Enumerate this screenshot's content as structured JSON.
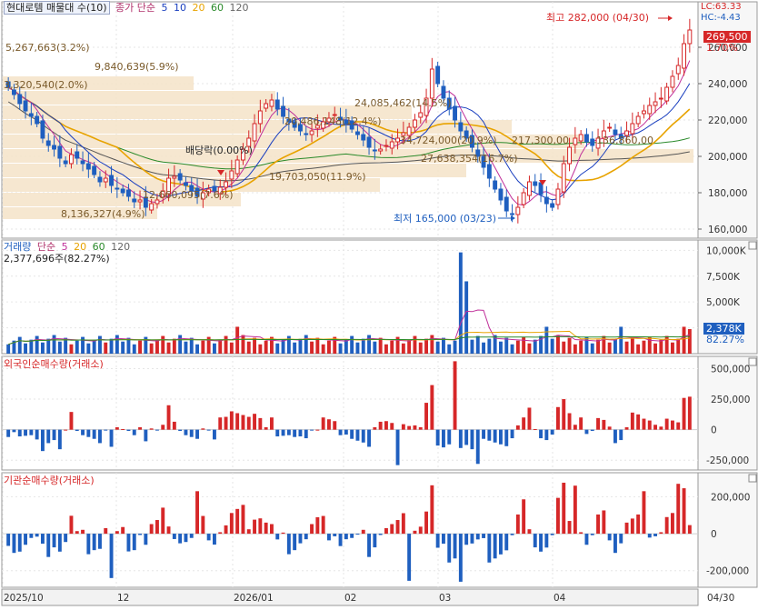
{
  "price_panel": {
    "legend": {
      "name": "현대로템 매물대 수(10)",
      "series_label": "종가 단순",
      "ma_periods": [
        "5",
        "10",
        "20",
        "60",
        "120"
      ],
      "ma_colors": [
        "#1a3fbf",
        "#1a3fbf",
        "#e8a300",
        "#2a8a2a",
        "#555555"
      ]
    },
    "right_labels": {
      "lc": "LC:63.33",
      "hc": "HC:-4.43"
    },
    "current_price": "269,500",
    "current_change": "1.70%",
    "high_annotation": "최고 282,000 (04/30)",
    "low_annotation": "최저 165,000 (03/23)",
    "dividend_label": "배당락(0.00%)",
    "volume_profile_labels": [
      "5,267,663(3.2%)",
      "9,840,639(5.9%)",
      "3,320,540(2.0%)",
      "24,085,462(14.5%)",
      "20,486,148(12.4%)",
      "34,724,000(20.9%)",
      "217,300,00",
      "136,860,00",
      "27,638,354(16.7%)",
      "19,703,050(11.9%)",
      "12,660,095(7.6%)",
      "8,136,327(4.9%)"
    ],
    "axis_ticks": [
      "260,000",
      "240,000",
      "220,000",
      "200,000",
      "180,000",
      "160,000"
    ],
    "up_color": "#d62728",
    "down_color": "#1f5fbf"
  },
  "volume_panel": {
    "title": "거래량",
    "legend_label": "단순",
    "ma_periods": [
      "5",
      "20",
      "60",
      "120"
    ],
    "info": "2,377,696주(82.27%)",
    "current_value": "2,378K",
    "current_pct": "82.27%",
    "axis_ticks": [
      "10,000K",
      "7,500K",
      "5,000K",
      "2,500K"
    ]
  },
  "foreign_panel": {
    "title": "외국인순매수량(거래소)",
    "axis_ticks": [
      "500,000",
      "250,000",
      "0",
      "-250,000"
    ]
  },
  "inst_panel": {
    "title": "기관순매수량(거래소)",
    "axis_ticks": [
      "200,000",
      "0",
      "-200,000"
    ]
  },
  "x_axis": [
    "2025/10",
    "12",
    "2026/01",
    "02",
    "03",
    "04",
    "04/30"
  ],
  "chart_data": [
    {
      "type": "candlestick",
      "title": "현대로템 매물대 수(10)",
      "y_range": [
        155000,
        285000
      ],
      "x_labels": [
        "2025/10",
        "12",
        "2026/01",
        "02",
        "03",
        "04",
        "04/30"
      ],
      "high": 282000,
      "high_date": "04/30",
      "low": 165000,
      "low_date": "03/23",
      "last_close": 269500,
      "closes": [
        238000,
        234000,
        229000,
        225000,
        222000,
        218000,
        210000,
        206000,
        204000,
        199000,
        196000,
        201000,
        199000,
        196000,
        193000,
        190000,
        186000,
        188000,
        184000,
        182000,
        180000,
        178000,
        175000,
        176000,
        172000,
        174000,
        176000,
        181000,
        188000,
        189000,
        187000,
        184000,
        181000,
        178000,
        180000,
        182000,
        181000,
        183000,
        186000,
        192000,
        198000,
        204000,
        210000,
        218000,
        225000,
        229000,
        231000,
        226000,
        222000,
        219000,
        216000,
        214000,
        212000,
        214000,
        217000,
        219000,
        221000,
        223000,
        220000,
        218000,
        215000,
        212000,
        209000,
        205000,
        203000,
        204000,
        206000,
        208000,
        210000,
        213000,
        216000,
        220000,
        224000,
        232000,
        248000,
        240000,
        232000,
        226000,
        220000,
        214000,
        210000,
        205000,
        200000,
        194000,
        188000,
        182000,
        176000,
        170000,
        168000,
        172000,
        180000,
        186000,
        184000,
        179000,
        174000,
        172000,
        182000,
        196000,
        205000,
        210000,
        212000,
        208000,
        206000,
        210000,
        214000,
        216000,
        212000,
        210000,
        214000,
        218000,
        222000,
        225000,
        228000,
        230000,
        232000,
        238000,
        244000,
        250000,
        262000,
        269500
      ]
    },
    {
      "type": "bar",
      "title": "거래량",
      "y_range": [
        0,
        11000
      ],
      "unit": "K",
      "last_value": 2378,
      "last_pct": 82.27
    },
    {
      "type": "bar",
      "title": "외국인순매수량(거래소)",
      "y_range": [
        -330000,
        600000
      ]
    },
    {
      "type": "bar",
      "title": "기관순매수량(거래소)",
      "y_range": [
        -290000,
        330000
      ]
    }
  ]
}
